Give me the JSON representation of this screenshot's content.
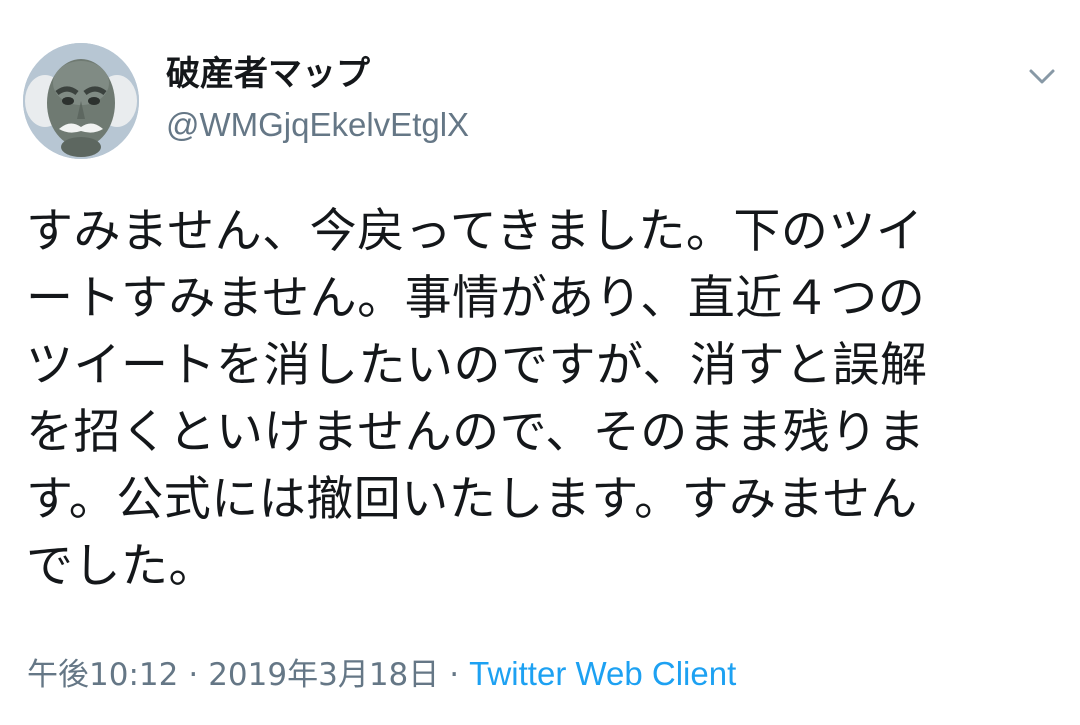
{
  "author": {
    "display_name": "破産者マップ",
    "handle": "@WMGjqEkelvEtglX",
    "avatar_icon": "avatar-bald-man-illustration"
  },
  "menu": {
    "caret_icon": "chevron-down-icon"
  },
  "tweet": {
    "text": "すみません、今戻ってきました。下のツイ\nートすみません。事情があり、直近４つの\nツイートを消したいのですが、消すと誤解\nを招くといけませんので、そのまま残りま\nす。公式には撤回いたします。すみません\nでした。"
  },
  "meta": {
    "time": "午後10:12",
    "separator_1": "·",
    "date": "2019年3月18日",
    "separator_2": "·",
    "source": "Twitter Web Client"
  },
  "colors": {
    "text": "#14171a",
    "secondary": "#657786",
    "link": "#1da1f2",
    "background": "#ffffff"
  }
}
